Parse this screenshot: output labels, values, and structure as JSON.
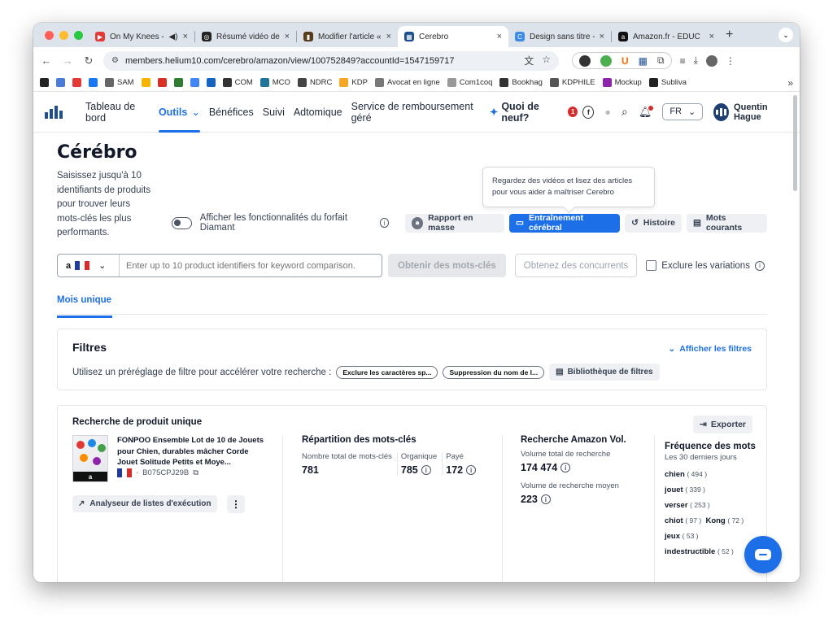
{
  "browser": {
    "tabs": [
      {
        "title": "On My Knees -",
        "icon": "youtube-icon",
        "color": "#e53935",
        "glyph": "▶"
      },
      {
        "title": "Résumé vidéo dem",
        "icon": "openai-icon",
        "color": "#222222",
        "glyph": "◎"
      },
      {
        "title": "Modifier l'article «",
        "icon": "book-icon",
        "color": "#5a3b1a",
        "glyph": "▮"
      },
      {
        "title": "Cerebro",
        "icon": "helium10-icon",
        "color": "#1d4f91",
        "glyph": "▦"
      },
      {
        "title": "Design sans titre -",
        "icon": "canva-icon",
        "color": "#3d8be8",
        "glyph": "C"
      },
      {
        "title": "Amazon.fr - ÉDUC",
        "icon": "amazon-icon",
        "color": "#111111",
        "glyph": "a"
      }
    ],
    "active_tab": 3,
    "new_tab": "+",
    "url": "members.helium10.com/cerebro/amazon/view/100752849?accountId=1547159717",
    "bookmarks": [
      {
        "label": "",
        "icon": "k-icon",
        "color": "#222"
      },
      {
        "label": "",
        "icon": "mail-icon",
        "color": "#4a7bd6"
      },
      {
        "label": "",
        "icon": "youtube-bm-icon",
        "color": "#e53935"
      },
      {
        "label": "",
        "icon": "facebook-bm-icon",
        "color": "#1877f2"
      },
      {
        "label": "SAM",
        "icon": "sam-icon",
        "color": "#666"
      },
      {
        "label": "",
        "icon": "drive-icon",
        "color": "#f5b400"
      },
      {
        "label": "",
        "icon": "gmail-icon",
        "color": "#d93025"
      },
      {
        "label": "",
        "icon": "box-icon",
        "color": "#2e7d32"
      },
      {
        "label": "",
        "icon": "chrome-icon",
        "color": "#4285f4"
      },
      {
        "label": "",
        "icon": "v-icon",
        "color": "#1565c0"
      },
      {
        "label": "COM",
        "icon": "github-icon",
        "color": "#333"
      },
      {
        "label": "MCO",
        "icon": "wordpress-icon",
        "color": "#21759b"
      },
      {
        "label": "NDRC",
        "icon": "hat-icon",
        "color": "#444"
      },
      {
        "label": "KDP",
        "icon": "kdp-icon",
        "color": "#f5a623"
      },
      {
        "label": "Avocat en ligne",
        "icon": "doc-icon",
        "color": "#777"
      },
      {
        "label": "Com1coq",
        "icon": "feather-icon",
        "color": "#999"
      },
      {
        "label": "Bookhag",
        "icon": "books-icon",
        "color": "#333"
      },
      {
        "label": "KDPHILE",
        "icon": "monitor-icon",
        "color": "#555"
      },
      {
        "label": "Mockup",
        "icon": "mockup-icon",
        "color": "#8e24aa"
      },
      {
        "label": "Subliva",
        "icon": "subliva-icon",
        "color": "#222"
      }
    ],
    "bookmarks_more": "»"
  },
  "nav": {
    "items": [
      "Tableau de bord",
      "Outils",
      "Bénéfices",
      "Suivi",
      "Adtomique",
      "Service de remboursement géré"
    ],
    "active": "Outils",
    "whats_new": "Quoi de neuf?",
    "whats_new_badge": "1",
    "lang": "FR",
    "user": "Quentin Hague"
  },
  "page": {
    "title": "Cérébro",
    "subtitle": "Saisissez jusqu'à 10 identifiants de produits pour trouver leurs mots-clés les plus performants.",
    "tooltip": "Regardez des vidéos et lisez des articles pour vous aider à maîtriser Cerebro",
    "diamond_toggle": "Afficher les fonctionnalités du forfait Diamant",
    "btn_bulk": "Rapport en masse",
    "btn_training": "Entraînement cérébral",
    "btn_history": "Histoire",
    "btn_common": "Mots courants",
    "marketplace": "a",
    "search_placeholder": "Enter up to 10 product identifiers for keyword comparison.",
    "btn_get_keywords": "Obtenir des mots-clés",
    "btn_competitors": "Obtenez des concurrents",
    "exclude_variations": "Exclure les variations",
    "tab_single": "Mois unique"
  },
  "filters": {
    "title": "Filtres",
    "show": "Afficher les filtres",
    "preset_label": "Utilisez un préréglage de filtre pour accélérer votre recherche :",
    "chips": [
      "Exclure les caractères sp...",
      "Suppression du nom de l..."
    ],
    "library": "Bibliothèque de filtres"
  },
  "product": {
    "section_title": "Recherche de produit unique",
    "export": "Exporter",
    "name": "FONPOO Ensemble Lot de 10 de Jouets pour Chien, durables mâcher Corde Jouet Solitude Petits et Moye...",
    "asin": "B075CPJ29B",
    "run_list": "Analyseur de listes d'exécution",
    "more": "⋮",
    "thumb_badge": "a",
    "kw_title": "Répartition des mots-clés",
    "kw_total_label": "Nombre total de mots-clés",
    "kw_total": "781",
    "kw_organic_label": "Organique",
    "kw_organic": "785",
    "kw_paid_label": "Payé",
    "kw_paid": "172",
    "vol_title": "Recherche Amazon Vol.",
    "vol_total_label": "Volume total de recherche",
    "vol_total": "174 474",
    "vol_avg_label": "Volume de recherche moyen",
    "vol_avg": "223",
    "freq_title": "Fréquence des mots",
    "freq_sub": "Les 30 derniers jours",
    "freq": [
      {
        "w": "chien",
        "n": "( 494 )"
      },
      {
        "w": "jouet",
        "n": "( 339 )"
      },
      {
        "w": "verser",
        "n": "( 253 )"
      },
      {
        "w": "chiot",
        "n": "( 97 )",
        "w2": "Kong",
        "n2": "( 72 )"
      },
      {
        "w": "jeux",
        "n": "( 53 )"
      },
      {
        "w": "indestructible",
        "n": "( 52 )"
      }
    ]
  }
}
